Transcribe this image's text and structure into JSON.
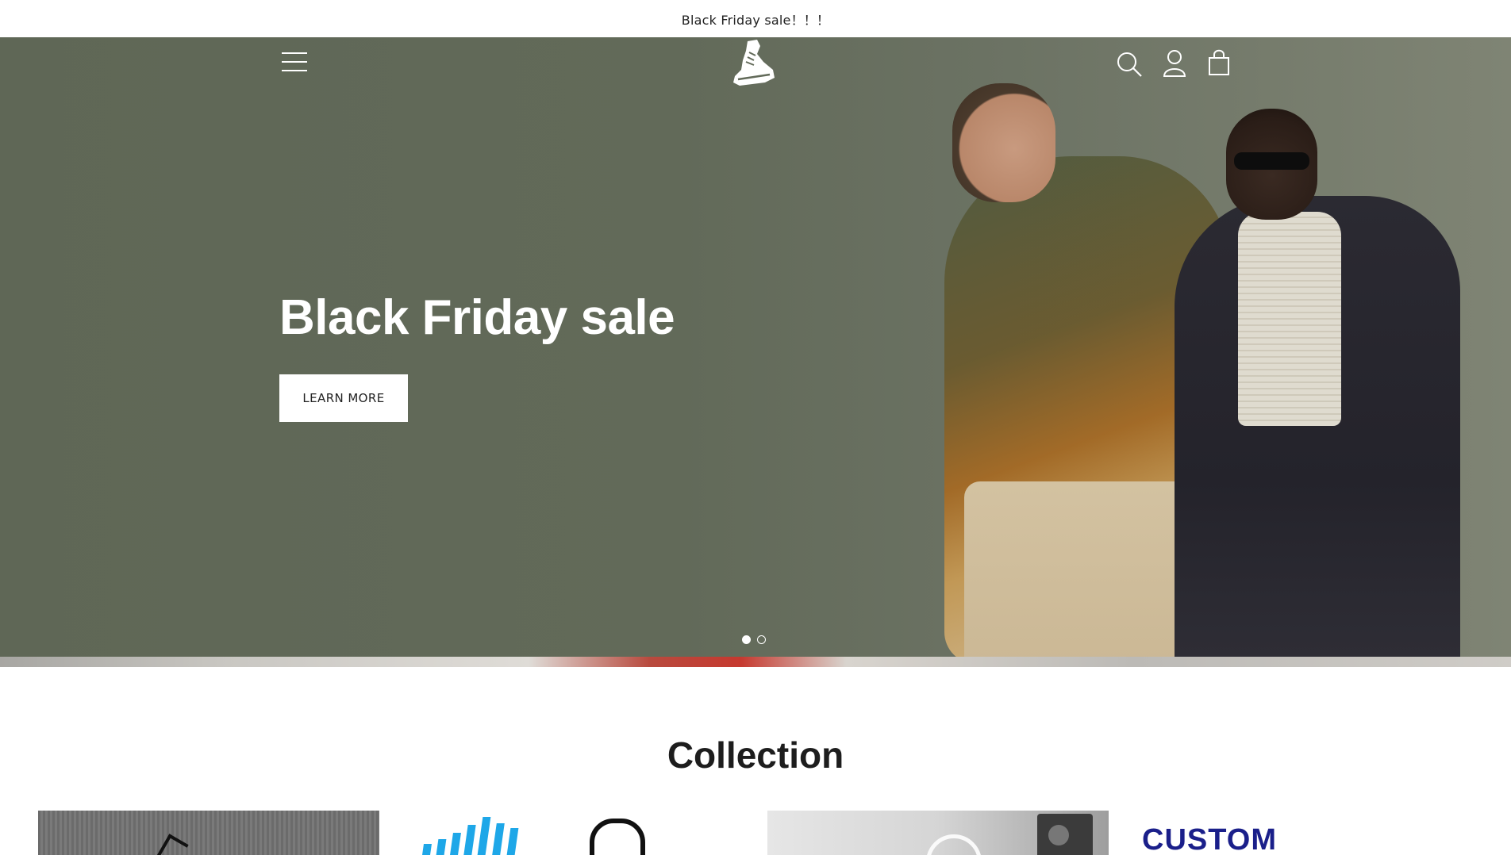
{
  "announcement": {
    "text": "Black Friday sale！！！"
  },
  "header": {
    "menu_icon": "menu-icon",
    "logo_icon": "sneaker-logo-icon",
    "search_icon": "search-icon",
    "account_icon": "account-icon",
    "cart_icon": "cart-bag-icon"
  },
  "hero": {
    "title": "Black Friday sale",
    "button_label": "LEARN MORE",
    "slides_total": 2,
    "active_slide": 1
  },
  "collection": {
    "title": "Collection",
    "cards": [
      {
        "name": "collection-card-1"
      },
      {
        "name": "collection-card-2"
      },
      {
        "name": "collection-card-3"
      },
      {
        "name": "collection-card-4",
        "text": "CUSTOM"
      }
    ]
  },
  "colors": {
    "hero_bg": "#626a59",
    "custom_text": "#1a1f8a",
    "brand_blue": "#1ea7e8"
  }
}
